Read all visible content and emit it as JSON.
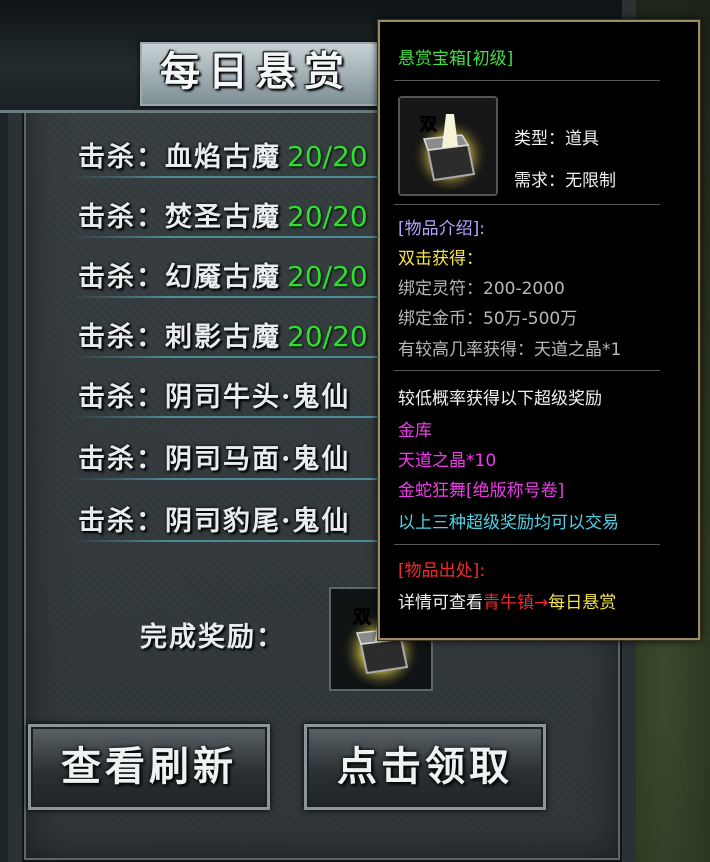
{
  "panel": {
    "title": "每日悬赏",
    "quests": [
      {
        "label": "击杀：",
        "target": "血焰古魔",
        "count": "20/20"
      },
      {
        "label": "击杀：",
        "target": "焚圣古魔",
        "count": "20/20"
      },
      {
        "label": "击杀：",
        "target": "幻魇古魔",
        "count": "20/20"
      },
      {
        "label": "击杀：",
        "target": "刺影古魔",
        "count": "20/20"
      },
      {
        "label": "击杀：",
        "target": "阴司牛头·鬼仙",
        "count": ""
      },
      {
        "label": "击杀：",
        "target": "阴司马面·鬼仙",
        "count": ""
      },
      {
        "label": "击杀：",
        "target": "阴司豹尾·鬼仙",
        "count": ""
      }
    ],
    "reward_label": "完成奖励：",
    "reward_icon_glyph": "双",
    "buttons": {
      "refresh": "查看刷新",
      "claim": "点击领取"
    }
  },
  "tooltip": {
    "name": "悬赏宝箱[初级]",
    "icon_glyph": "双",
    "type_line": "类型：道具",
    "req_line": "需求：无限制",
    "intro_header": "[物品介绍]:",
    "double_gain": "双击获得：",
    "bind_rune": "绑定灵符：200-2000",
    "bind_gold": "绑定金币：50万-500万",
    "high_rate": "有较高几率获得：天道之晶*1",
    "low_rate_header": "较低概率获得以下超级奖励",
    "super_rewards": [
      "金库",
      "天道之晶*10",
      "金蛇狂舞[绝版称号卷]"
    ],
    "tradeable": "以上三种超级奖励均可以交易",
    "source_header": "[物品出处]:",
    "source_prefix": "详情可查看",
    "source_place": "青牛镇",
    "source_arrow": "→",
    "source_dest": "每日悬赏"
  },
  "colors": {
    "count_green": "#2ee02e",
    "tooltip_border": "#9b8a60",
    "name_green": "#3ee13e",
    "intro_purple": "#b9a2ff",
    "yellow": "#f6e64a",
    "magenta": "#ee3cea",
    "cyan": "#4ed2e4",
    "red": "#f02a2a"
  }
}
